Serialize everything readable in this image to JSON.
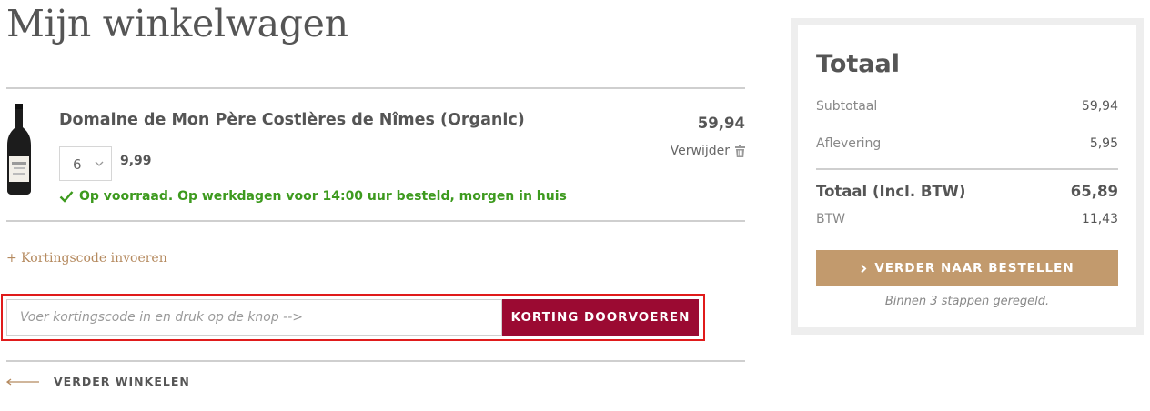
{
  "page": {
    "title": "Mijn winkelwagen"
  },
  "cart": {
    "items": [
      {
        "name": "Domaine de Mon Père Costières de Nîmes (Organic)",
        "quantity": "6",
        "unit_price": "9,99",
        "stock": "Op voorraad. Op werkdagen voor 14:00 uur besteld, morgen in huis",
        "line_total": "59,94",
        "remove_label": "Verwijder"
      }
    ]
  },
  "coupon": {
    "toggle_label": "+ Kortingscode invoeren",
    "placeholder": "Voer kortingscode in en druk op de knop -->",
    "button_label": "KORTING DOORVOEREN"
  },
  "continue_shopping": "VERDER WINKELEN",
  "summary": {
    "title": "Totaal",
    "subtotal_label": "Subtotaal",
    "subtotal_value": "59,94",
    "delivery_label": "Aflevering",
    "delivery_value": "5,95",
    "total_label": "Totaal (Incl. BTW)",
    "total_value": "65,89",
    "vat_label": "BTW",
    "vat_value": "11,43",
    "checkout_label": "VERDER NAAR BESTELLEN",
    "note": "Binnen 3 stappen geregeld."
  },
  "colors": {
    "coupon_button": "#9b0a32",
    "checkout_button": "#c29a6d",
    "stock_green": "#3d9a1e",
    "highlight_border": "#e01b1b"
  },
  "icons": {
    "stock": "check-icon",
    "remove": "trash-icon",
    "qty": "chevron-down-icon",
    "continue": "arrow-left-icon",
    "checkout": "chevron-right-icon"
  }
}
